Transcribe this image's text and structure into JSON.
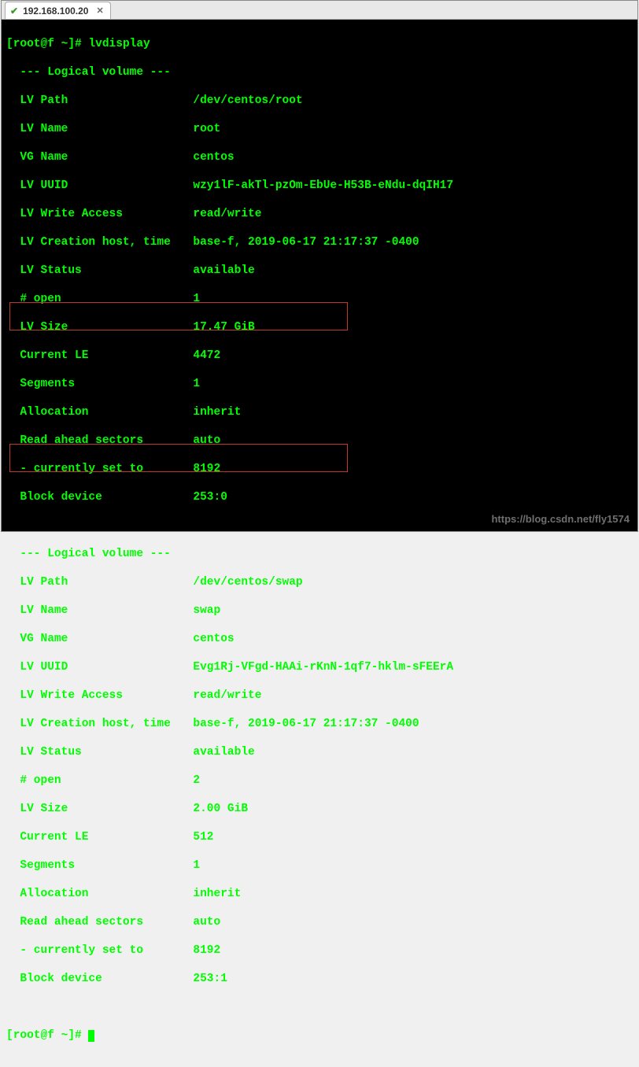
{
  "tab": {
    "title": "192.168.100.20",
    "status": "connected"
  },
  "prompt": {
    "user_host": "root@f",
    "dir": "~",
    "symbol": "#",
    "open": "[",
    "close": "]"
  },
  "command": "lvdisplay",
  "sep": "  --- Logical volume ---",
  "lv1": {
    "path_l": "LV Path",
    "path_v": "/dev/centos/root",
    "name_l": "LV Name",
    "name_v": "root",
    "vg_l": "VG Name",
    "vg_v": "centos",
    "uuid_l": "LV UUID",
    "uuid_v": "wzy1lF-akTl-pzOm-EbUe-H53B-eNdu-dqIH17",
    "wa_l": "LV Write Access",
    "wa_v": "read/write",
    "ch_l": "LV Creation host, time",
    "ch_v": "base-f, 2019-06-17 21:17:37 -0400",
    "st_l": "LV Status",
    "st_v": "available",
    "op_l": "# open",
    "op_v": "1",
    "sz_l": "LV Size",
    "sz_v": "17.47 GiB",
    "le_l": "Current LE",
    "le_v": "4472",
    "sg_l": "Segments",
    "sg_v": "1",
    "al_l": "Allocation",
    "al_v": "inherit",
    "ra_l": "Read ahead sectors",
    "ra_v": "auto",
    "cs_l": "- currently set to",
    "cs_v": "8192",
    "bd_l": "Block device",
    "bd_v": "253:0"
  },
  "lv2": {
    "path_l": "LV Path",
    "path_v": "/dev/centos/swap",
    "name_l": "LV Name",
    "name_v": "swap",
    "vg_l": "VG Name",
    "vg_v": "centos",
    "uuid_l": "LV UUID",
    "uuid_v": "Evg1Rj-VFgd-HAAi-rKnN-1qf7-hklm-sFEErA",
    "wa_l": "LV Write Access",
    "wa_v": "read/write",
    "ch_l": "LV Creation host, time",
    "ch_v": "base-f, 2019-06-17 21:17:37 -0400",
    "st_l": "LV Status",
    "st_v": "available",
    "op_l": "# open",
    "op_v": "2",
    "sz_l": "LV Size",
    "sz_v": "2.00 GiB",
    "le_l": "Current LE",
    "le_v": "512",
    "sg_l": "Segments",
    "sg_v": "1",
    "al_l": "Allocation",
    "al_v": "inherit",
    "ra_l": "Read ahead sectors",
    "ra_v": "auto",
    "cs_l": "- currently set to",
    "cs_v": "8192",
    "bd_l": "Block device",
    "bd_v": "253:1"
  },
  "watermark": "https://blog.csdn.net/fly1574"
}
